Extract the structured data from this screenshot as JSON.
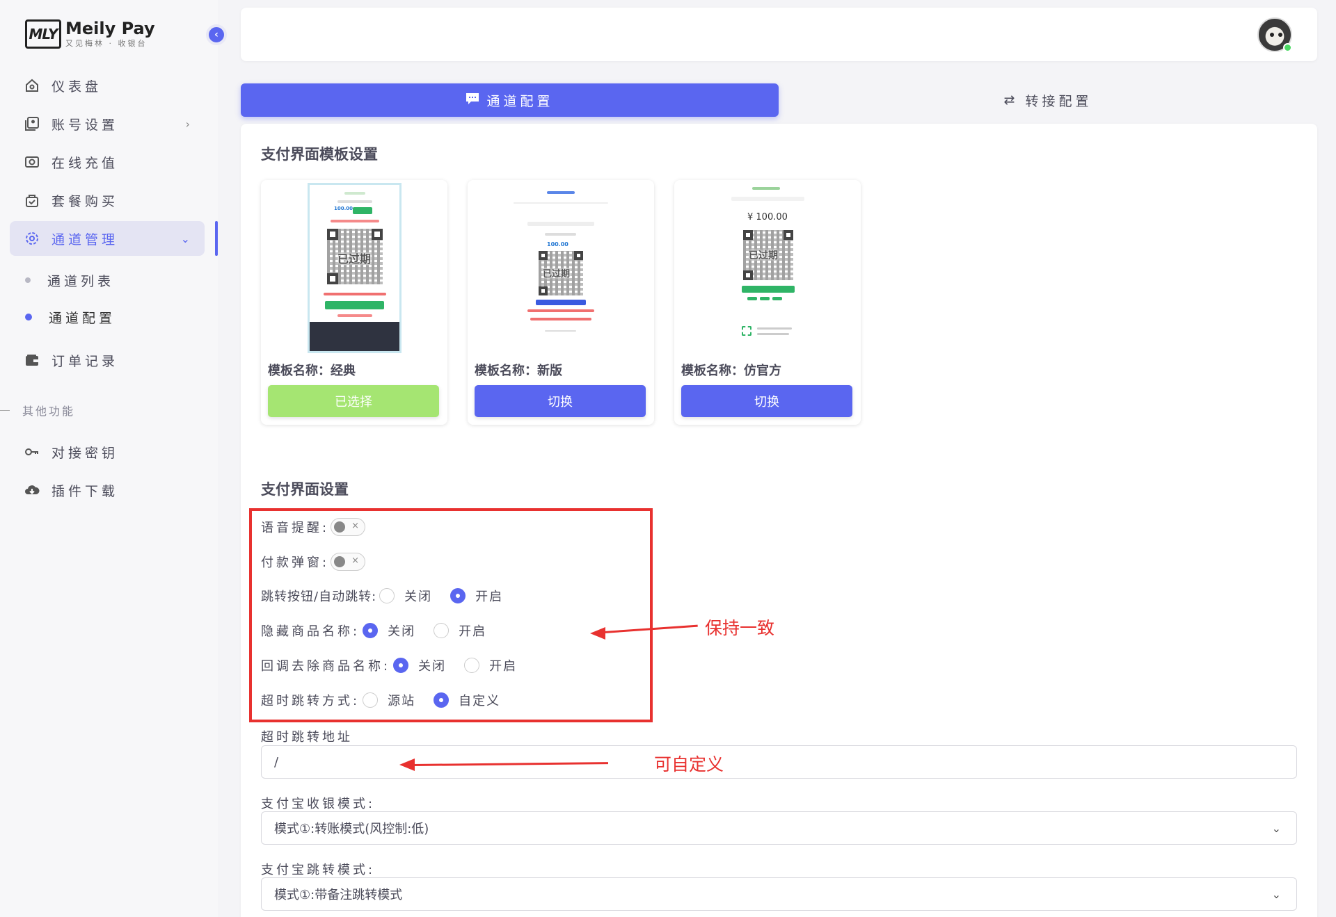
{
  "brand": {
    "logo_mark": "MLY",
    "name": "Meily Pay",
    "tagline": "又见梅林 · 收银台"
  },
  "sidebar": {
    "items": [
      {
        "label": "仪表盘",
        "icon": "home-icon"
      },
      {
        "label": "账号设置",
        "icon": "user-card-icon"
      },
      {
        "label": "在线充值",
        "icon": "camera-icon"
      },
      {
        "label": "套餐购买",
        "icon": "bag-icon"
      },
      {
        "label": "通道管理",
        "icon": "gear-icon"
      },
      {
        "label": "订单记录",
        "icon": "wallet-icon"
      }
    ],
    "sub_items": [
      {
        "label": "通道列表"
      },
      {
        "label": "通道配置"
      }
    ],
    "section_label": "其他功能",
    "extra_items": [
      {
        "label": "对接密钥",
        "icon": "key-icon"
      },
      {
        "label": "插件下载",
        "icon": "cloud-download-icon"
      }
    ]
  },
  "tabs": [
    {
      "label": "通道配置",
      "icon": "chat-icon",
      "active": true
    },
    {
      "label": "转接配置",
      "icon": "swap-icon",
      "active": false
    }
  ],
  "templates_section": {
    "title": "支付界面模板设置",
    "templates": [
      {
        "name": "模板名称：经典",
        "button": "已选择",
        "selected": true,
        "preview_overlay": "已过期",
        "preview_amount": "100.00"
      },
      {
        "name": "模板名称：新版",
        "button": "切换",
        "selected": false,
        "preview_overlay": "已过期",
        "preview_amount": "100.00"
      },
      {
        "name": "模板名称：仿官方",
        "button": "切换",
        "selected": false,
        "preview_overlay": "已过期",
        "preview_amount": "¥ 100.00"
      }
    ]
  },
  "settings_section": {
    "title": "支付界面设置",
    "voice_label": "语音提醒:",
    "popup_label": "付款弹窗:",
    "jump_label": "跳转按钮/自动跳转:",
    "jump_options": [
      "关闭",
      "开启"
    ],
    "hide_name_label": "隐藏商品名称:",
    "hide_name_options": [
      "关闭",
      "开启"
    ],
    "callback_label": "回调去除商品名称:",
    "callback_options": [
      "关闭",
      "开启"
    ],
    "timeout_label": "超时跳转方式:",
    "timeout_options": [
      "源站",
      "自定义"
    ],
    "timeout_url_label": "超时跳转地址",
    "timeout_url_value": "/",
    "alipay_mode_label": "支付宝收银模式:",
    "alipay_mode_value": "模式①:转账模式(风控制:低)",
    "alipay_jump_label": "支付宝跳转模式:",
    "alipay_jump_value": "模式①:带备注跳转模式"
  },
  "annotations": {
    "keep_consistent": "保持一致",
    "customizable": "可自定义"
  },
  "colors": {
    "accent": "#5a66f0",
    "selected_green": "#a5e572",
    "annotation_red": "#e8312f"
  }
}
